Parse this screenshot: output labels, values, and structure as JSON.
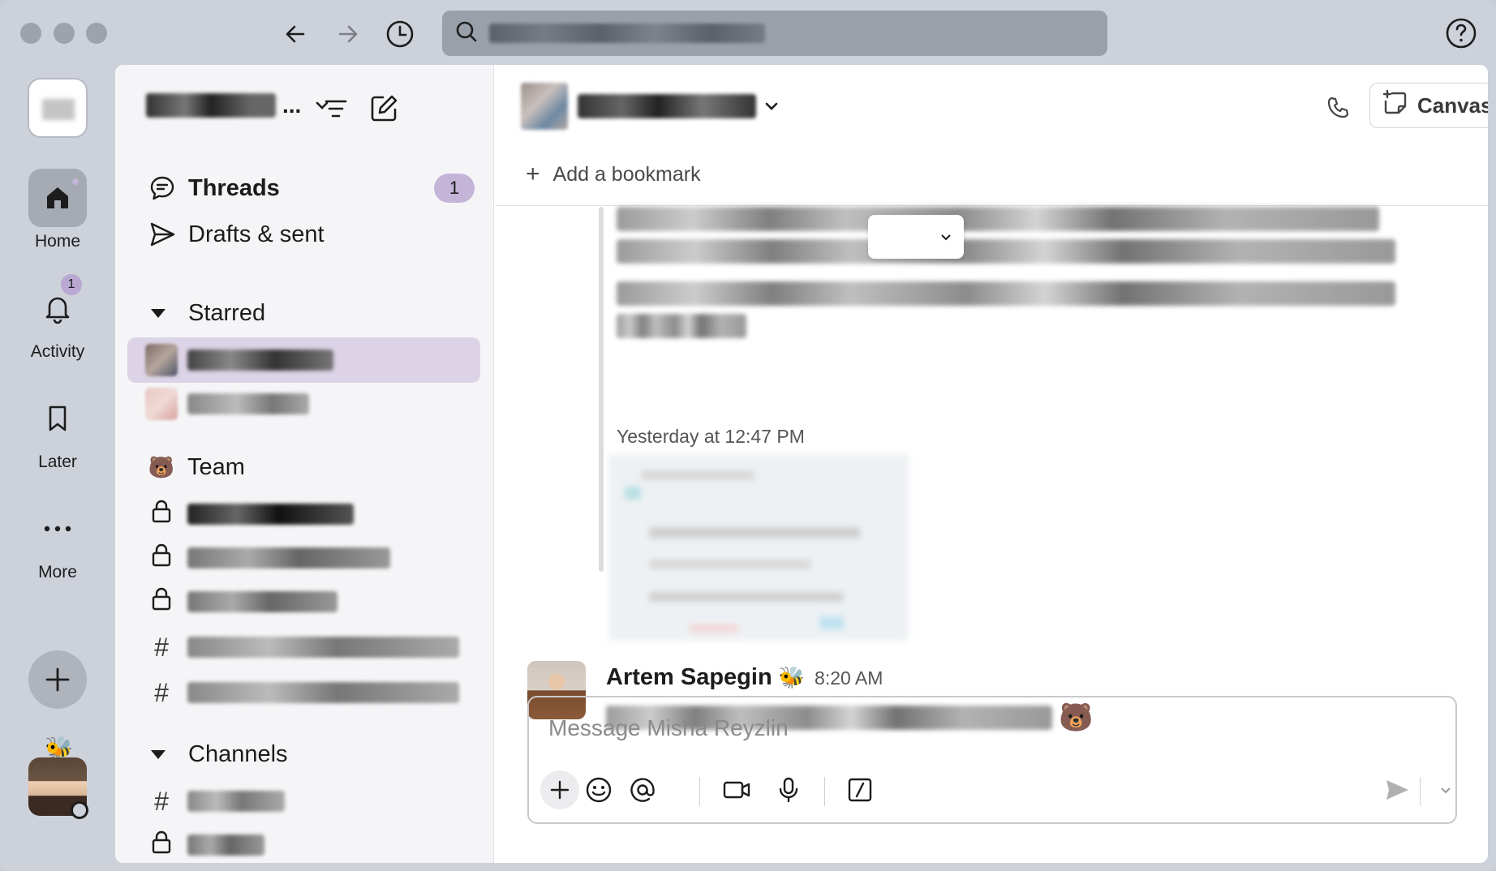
{
  "window": {
    "help_icon": "question-circle-icon"
  },
  "search": {
    "placeholder": "Search"
  },
  "rail": {
    "items": [
      {
        "label": "Home",
        "icon": "home-icon",
        "active": true
      },
      {
        "label": "Activity",
        "icon": "bell-icon",
        "badge": "1"
      },
      {
        "label": "Later",
        "icon": "bookmark-icon"
      },
      {
        "label": "More",
        "icon": "ellipsis-icon"
      }
    ]
  },
  "sidebar": {
    "nav": [
      {
        "label": "Threads",
        "icon": "threads-icon",
        "badge": "1"
      },
      {
        "label": "Drafts & sent",
        "icon": "send-icon"
      }
    ],
    "starred_heading": "Starred",
    "team_label": "Team",
    "team_emoji": "🐻",
    "channels_heading": "Channels"
  },
  "chat": {
    "bookmark_label": "Add a bookmark",
    "canvas_label": "Canvas",
    "timestamp": "Yesterday at 12:47 PM",
    "message": {
      "author": "Artem Sapegin",
      "author_emoji": "🐝",
      "time": "8:20 AM",
      "trailing_emoji": "🐻"
    },
    "composer_placeholder": "Message Misha Reyzlin"
  },
  "colors": {
    "accent_purple": "#c3b4d8",
    "active_row": "#dcd3e7",
    "rail_bg": "#cdd1d9"
  }
}
